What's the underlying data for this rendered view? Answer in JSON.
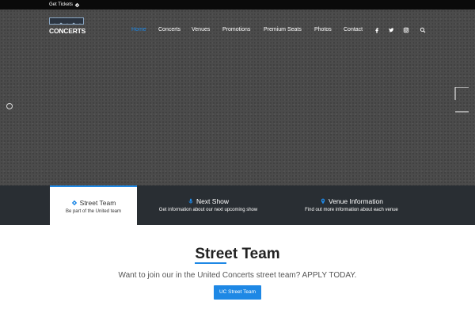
{
  "topbar": {
    "tickets_label": "Get Tickets",
    "ticket_icon": "ticket-icon"
  },
  "brand": {
    "logo_text": "CONCERTS"
  },
  "nav": {
    "items": [
      {
        "label": "Home",
        "active": true
      },
      {
        "label": "Concerts"
      },
      {
        "label": "Venues"
      },
      {
        "label": "Promotions"
      },
      {
        "label": "Premium Seats"
      },
      {
        "label": "Photos"
      },
      {
        "label": "Contact"
      }
    ],
    "icons": [
      "facebook-icon",
      "twitter-icon",
      "instagram-icon",
      "search-icon"
    ]
  },
  "features": [
    {
      "title": "Street Team",
      "subtitle": "Be part of the United team",
      "icon": "ticket-icon",
      "active": true
    },
    {
      "title": "Next Show",
      "subtitle": "Get information about our next upcoming show",
      "icon": "microphone-icon"
    },
    {
      "title": "Venue Information",
      "subtitle": "Find out more information about each venue",
      "icon": "map-marker-icon"
    }
  ],
  "section": {
    "title": "Street Team",
    "text": "Want to join our in the United Concerts street team? APPLY TODAY.",
    "button_label": "UC Street Team"
  },
  "colors": {
    "accent": "#1e88e5",
    "topbar": "#0a0a0a",
    "hero": "#4b4b4b",
    "features_bar": "#292e33"
  }
}
